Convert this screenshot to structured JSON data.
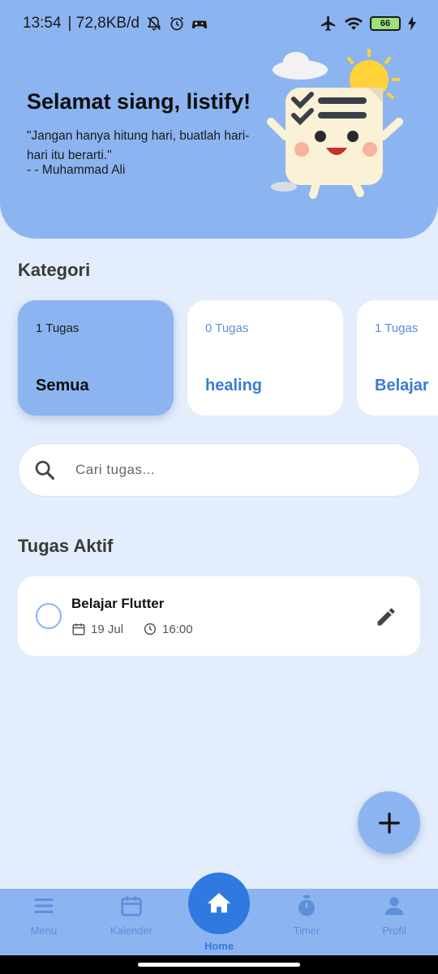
{
  "status_bar": {
    "time": "13:54",
    "network_speed": "| 72,8KB/d",
    "battery_level": "66",
    "icons": [
      "bell-off-icon",
      "alarm-icon",
      "game-controller-icon",
      "airplane-icon",
      "wifi-icon",
      "battery-icon",
      "charging-icon"
    ]
  },
  "header": {
    "greeting": "Selamat siang, listify!",
    "quote": "\"Jangan hanya hitung hari, buatlah hari-hari itu berarti.\"",
    "author": "- - Muhammad Ali"
  },
  "categories": {
    "title": "Kategori",
    "items": [
      {
        "count": "1 Tugas",
        "name": "Semua",
        "active": true
      },
      {
        "count": "0 Tugas",
        "name": "healing",
        "active": false
      },
      {
        "count": "1 Tugas",
        "name": "Belajar",
        "active": false
      }
    ]
  },
  "search": {
    "placeholder": "Cari tugas...",
    "value": ""
  },
  "active_tasks": {
    "title": "Tugas Aktif",
    "items": [
      {
        "title": "Belajar Flutter",
        "date": "19 Jul",
        "time": "16:00",
        "done": false
      }
    ]
  },
  "bottom_nav": {
    "items": [
      {
        "label": "Menu",
        "icon": "menu-icon"
      },
      {
        "label": "Kalender",
        "icon": "calendar-icon"
      },
      {
        "label": "Home",
        "icon": "home-icon"
      },
      {
        "label": "Timer",
        "icon": "timer-icon"
      },
      {
        "label": "Profil",
        "icon": "person-icon"
      }
    ]
  },
  "colors": {
    "primary": "#3079e0",
    "header": "#8cb4f0",
    "background": "#e3edfb"
  }
}
